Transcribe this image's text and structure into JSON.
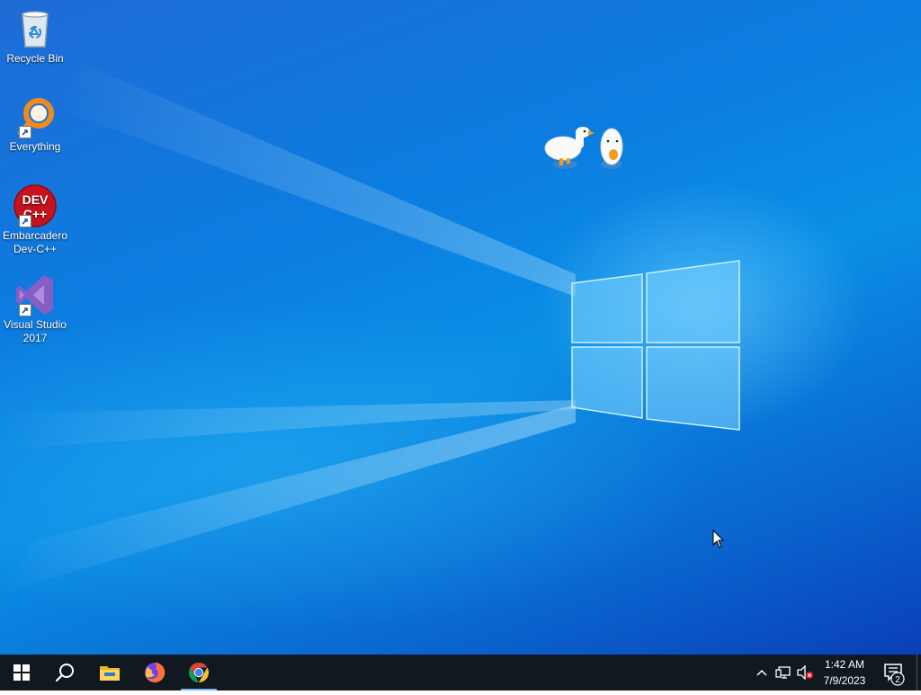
{
  "desktop": {
    "icons": [
      {
        "label": "Recycle Bin",
        "icon": "recycle-bin-icon"
      },
      {
        "label": "Everything",
        "icon": "everything-search-icon"
      },
      {
        "label_line1": "Embarcadero",
        "label_line2": "Dev-C++",
        "icon": "dev-cpp-icon",
        "logo_text1": "DEV",
        "logo_text2": "C++"
      },
      {
        "label_line1": "Visual Studio",
        "label_line2": "2017",
        "icon": "visual-studio-icon"
      }
    ]
  },
  "taskbar": {
    "pinned": [
      {
        "name": "start-button",
        "icon": "windows-logo-icon"
      },
      {
        "name": "search-button",
        "icon": "search-icon"
      },
      {
        "name": "file-explorer",
        "icon": "folder-icon"
      },
      {
        "name": "firefox",
        "icon": "firefox-icon"
      },
      {
        "name": "chrome",
        "icon": "chrome-icon",
        "active": true
      }
    ],
    "tray": {
      "time": "1:42 AM",
      "date": "7/9/2023",
      "notification_count": "2"
    }
  },
  "colors": {
    "taskbar": "#101820",
    "desktop_blue": "#0a8fe6",
    "active_indicator": "#7ab8f0"
  }
}
